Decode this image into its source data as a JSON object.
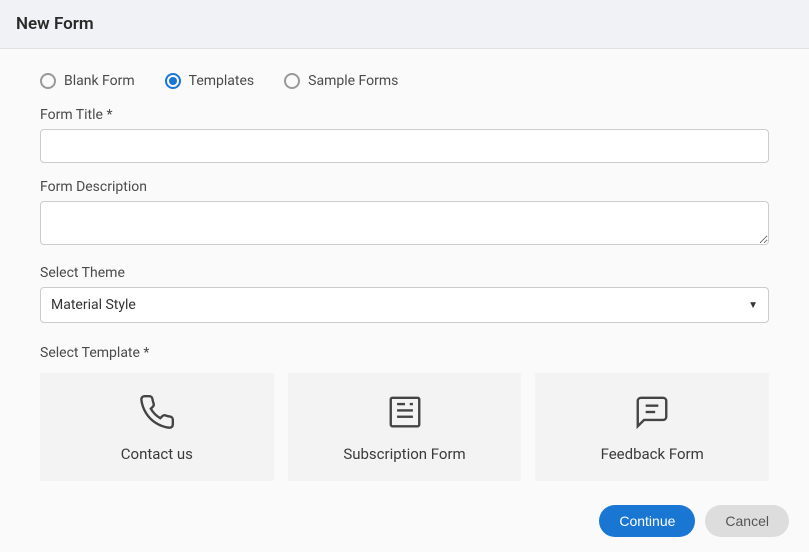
{
  "header": {
    "title": "New Form"
  },
  "formTypeOptions": {
    "blank": "Blank Form",
    "templates": "Templates",
    "sample": "Sample Forms"
  },
  "fields": {
    "titleLabel": "Form Title ",
    "titleRequired": "*",
    "titleValue": "",
    "descriptionLabel": "Form Description",
    "descriptionValue": "",
    "themeLabel": "Select Theme",
    "themeValue": "Material Style"
  },
  "templateSection": {
    "label": "Select Template ",
    "required": "*",
    "items": {
      "contact": "Contact us",
      "subscription": "Subscription Form",
      "feedback": "Feedback Form"
    }
  },
  "footer": {
    "continue": "Continue",
    "cancel": "Cancel"
  }
}
